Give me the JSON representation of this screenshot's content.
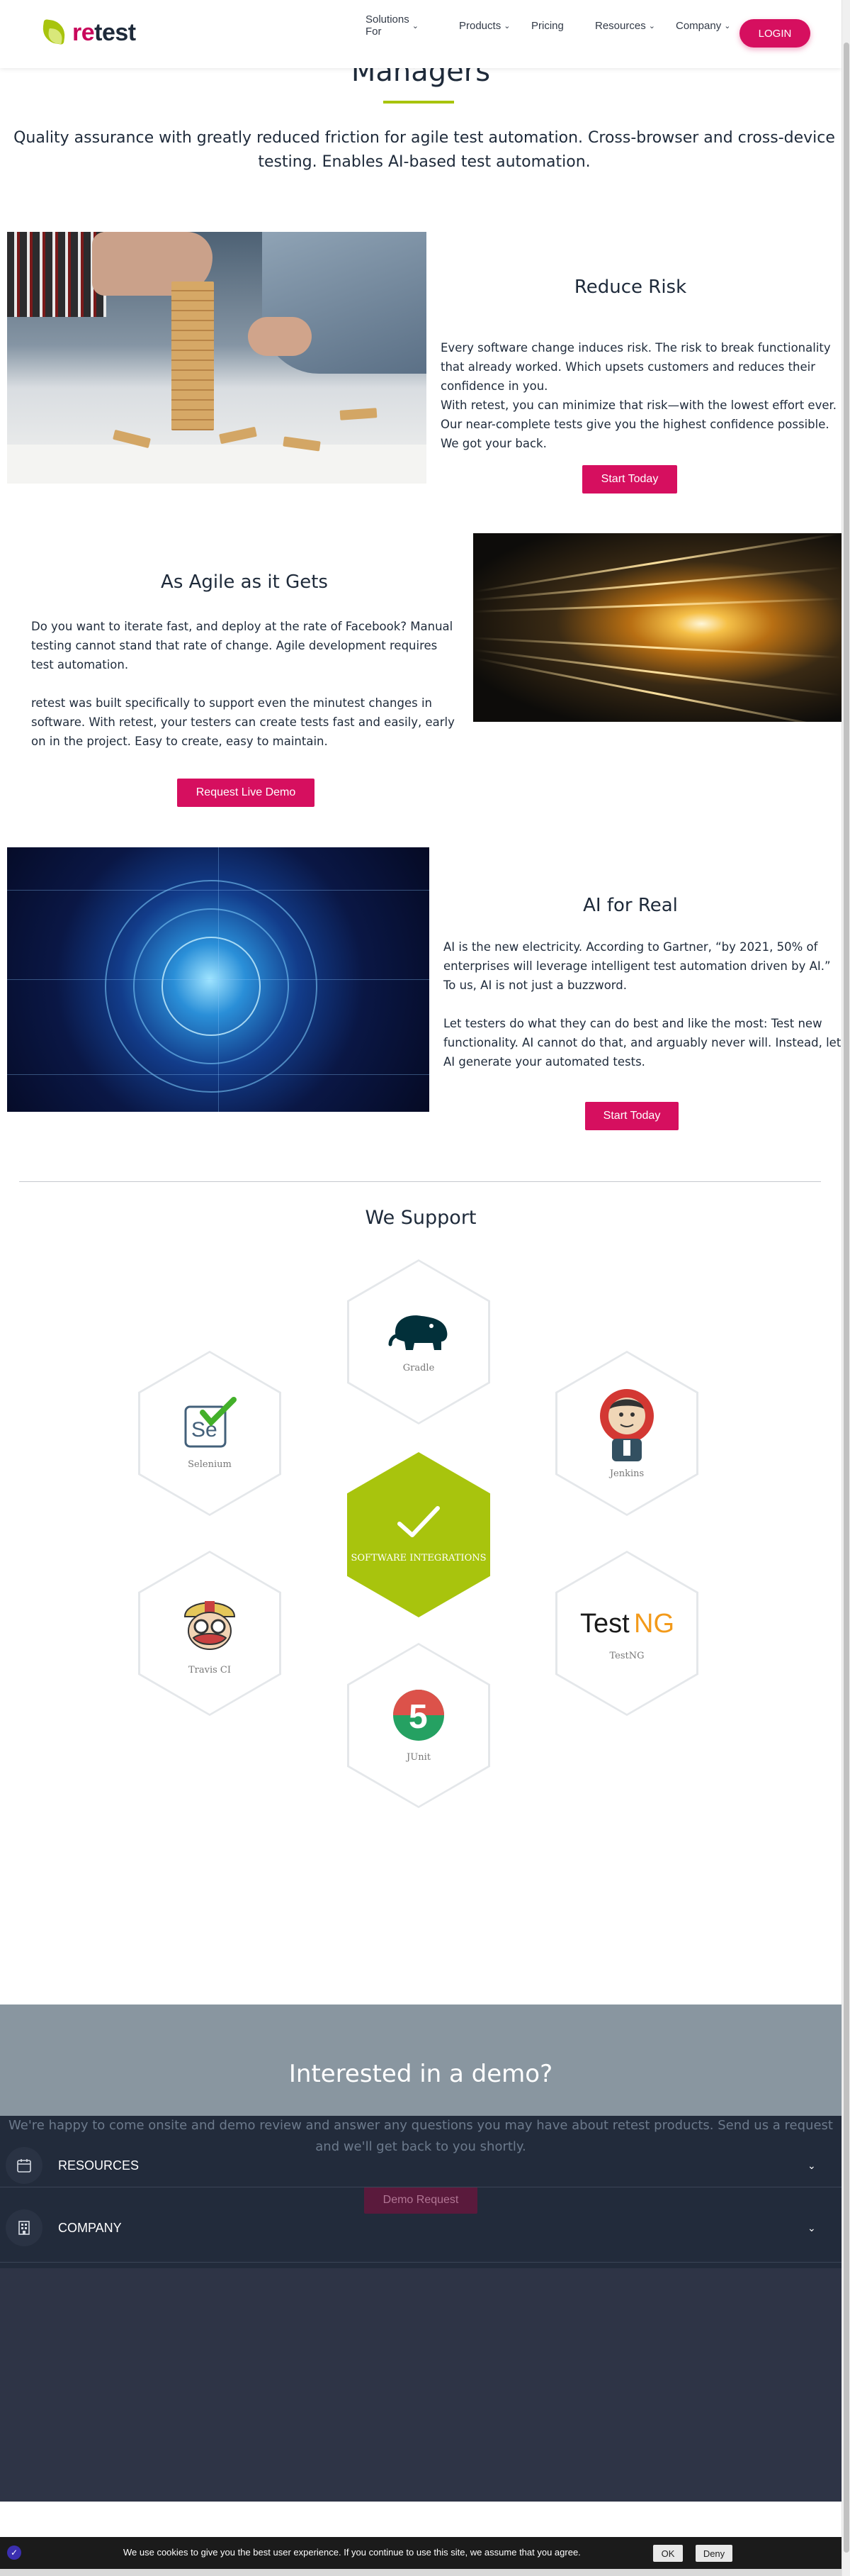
{
  "header": {
    "logo_prefix": "re",
    "logo_suffix": "test",
    "nav": [
      {
        "label": "Solutions For",
        "has_dropdown": true
      },
      {
        "label": "Products",
        "has_dropdown": true
      },
      {
        "label": "Pricing",
        "has_dropdown": false
      },
      {
        "label": "Resources",
        "has_dropdown": true
      },
      {
        "label": "Company",
        "has_dropdown": true
      }
    ],
    "login_label": "LOGIN",
    "accent_color": "#d60f5f",
    "brand_green": "#a8c40d"
  },
  "intro": {
    "title": "Managers",
    "text": "Quality assurance with greatly reduced friction for agile test automation. Cross-browser and cross-device testing. Enables AI-based test automation."
  },
  "features": [
    {
      "title": "Reduce Risk",
      "paragraphs": [
        "Every software change induces risk. The risk to break functionality that already worked. Which upsets customers and reduces their confidence in you.\nWith retest, you can minimize that risk—with the lowest effort ever. Our near-complete tests give you the highest confidence possible. We got your back."
      ],
      "cta": "Start Today",
      "image": "jenga-tower-photo"
    },
    {
      "title": "As Agile as it Gets",
      "paragraphs": [
        "Do you want to iterate fast, and deploy at the rate of Facebook? Manual testing cannot stand that rate of change. Agile development requires test automation.",
        "retest was built specifically to support even the minutest changes in software. With retest, your testers can create tests fast and easily, early on in the project. Easy to create, easy to maintain."
      ],
      "cta": "Request Live Demo",
      "image": "light-tunnel-photo"
    },
    {
      "title": "AI for Real",
      "paragraphs": [
        "AI is the new electricity. According to Gartner, “by 2021, 50% of enterprises will leverage intelligent test automation driven by AI.” To us, AI is not just a buzzword.",
        "Let testers do what they can do best and like the most: Test new functionality. AI cannot do that, and arguably never will. Instead, let AI generate your automated tests."
      ],
      "cta": "Start Today",
      "image": "ai-brain-photo"
    }
  ],
  "support": {
    "title": "We Support",
    "integrations": [
      {
        "name": "Gradle",
        "icon": "gradle-elephant-icon"
      },
      {
        "name": "Selenium",
        "icon": "selenium-icon"
      },
      {
        "name": "Jenkins",
        "icon": "jenkins-icon"
      },
      {
        "name": "Travis CI",
        "icon": "travis-ci-icon"
      },
      {
        "name": "TestNG",
        "icon": "testng-logo"
      },
      {
        "name": "JUnit",
        "icon": "junit5-icon"
      }
    ],
    "center_label": "SOFTWARE INTEGRATIONS",
    "center_icon": "checkmark-icon"
  },
  "demo": {
    "title": "Interested in a demo?",
    "text": "We're happy to come onsite and demo review and answer any questions you may have about retest products. Send us a request and we'll get back to you shortly.",
    "button": "Demo Request"
  },
  "footer": {
    "accordion": [
      {
        "label": "RESOURCES",
        "icon": "calendar-icon"
      },
      {
        "label": "COMPANY",
        "icon": "company-icon"
      }
    ]
  },
  "cookie": {
    "text": "We use cookies to give you the best user experience. If you continue to use this site, we assume that you agree.",
    "ok": "OK",
    "deny": "Deny"
  }
}
